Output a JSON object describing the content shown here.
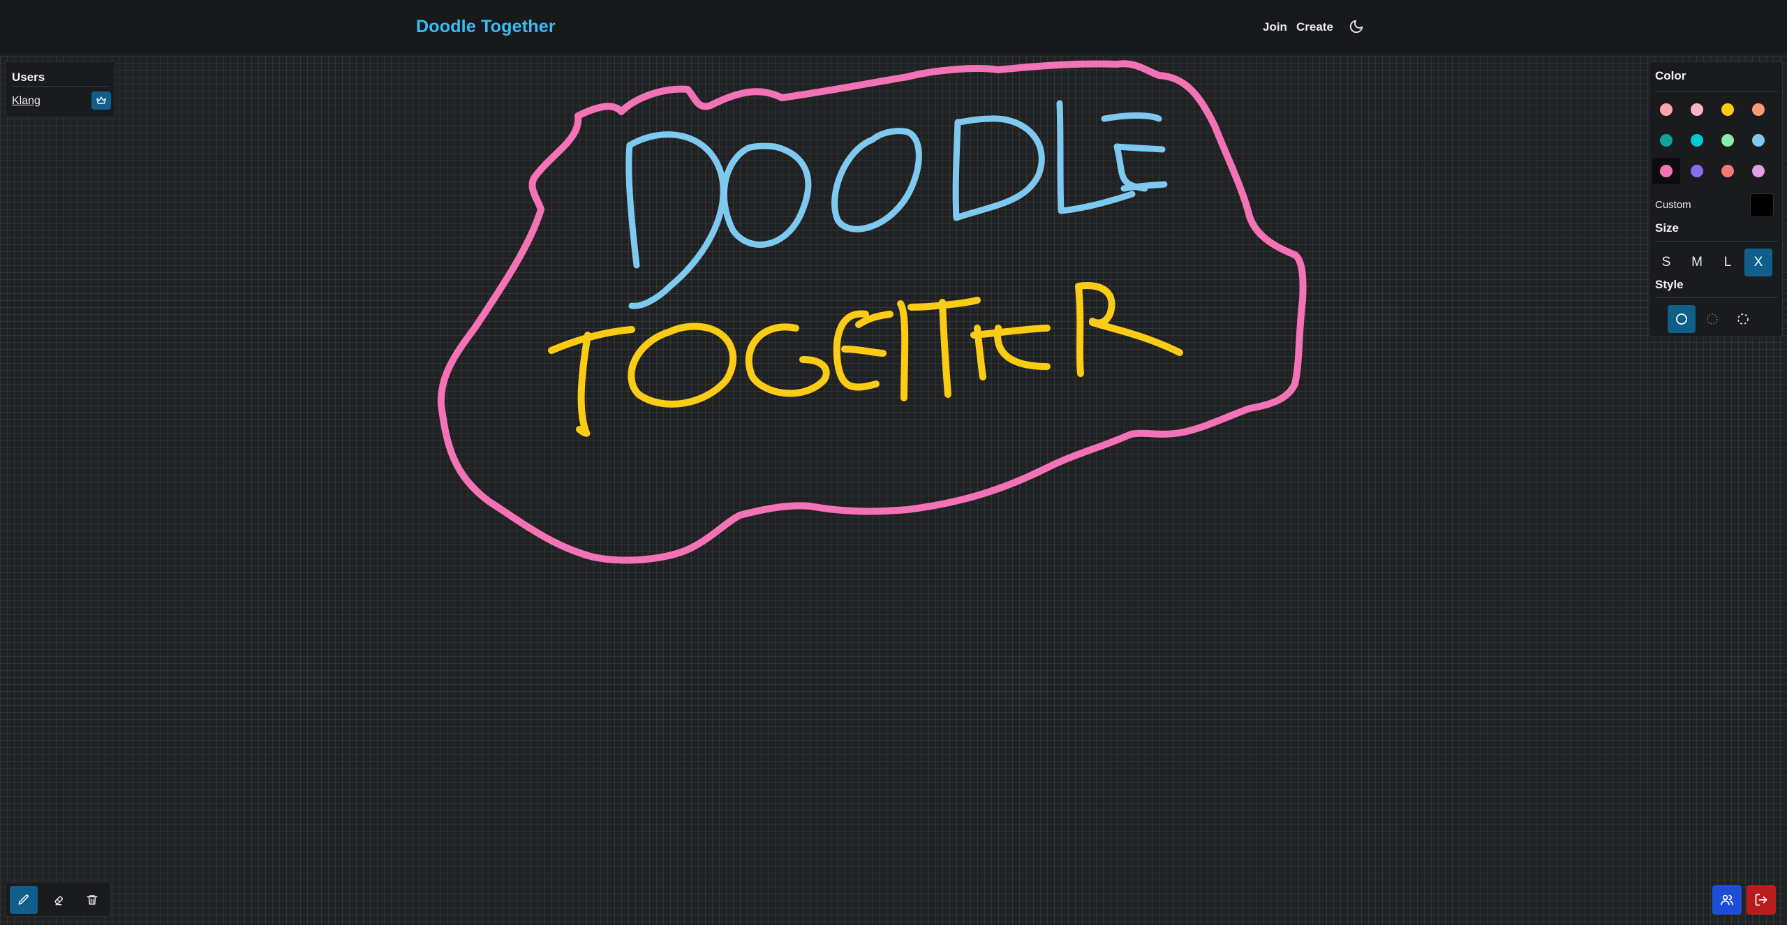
{
  "app": {
    "title": "Doodle Together"
  },
  "nav": {
    "join": "Join",
    "create": "Create",
    "theme_icon": "moon-icon"
  },
  "users": {
    "title": "Users",
    "list": [
      {
        "name": "Klang",
        "badge_icon": "crown-icon"
      }
    ]
  },
  "color": {
    "title": "Color",
    "swatches": [
      "#f9a8a8",
      "#f9b4c4",
      "#facc15",
      "#f69a78",
      "#14a39c",
      "#06c8d4",
      "#86efac",
      "#7dc9ef",
      "#f472b6",
      "#8b6cf0",
      "#f07a74",
      "#e09ee4"
    ],
    "selected": "#f472b6",
    "custom_label": "Custom",
    "custom_value": "#000000"
  },
  "size": {
    "title": "Size",
    "options": [
      "S",
      "M",
      "L",
      "X"
    ],
    "selected": "X"
  },
  "style": {
    "title": "Style",
    "options": [
      "solid",
      "dotted",
      "dashed"
    ],
    "selected": "solid"
  },
  "toolbar": {
    "tools": [
      "pencil-icon",
      "eraser-icon",
      "trash-icon"
    ],
    "active_tool": "pencil-icon"
  },
  "actions": {
    "users_icon": "users-icon",
    "leave_icon": "logout-icon"
  },
  "doodle": {
    "words": [
      "DOODLE",
      "TOGETHER"
    ],
    "colors": {
      "outline": "#f472b6",
      "top_word": "#7dc9ef",
      "bottom_word": "#facc15"
    }
  }
}
